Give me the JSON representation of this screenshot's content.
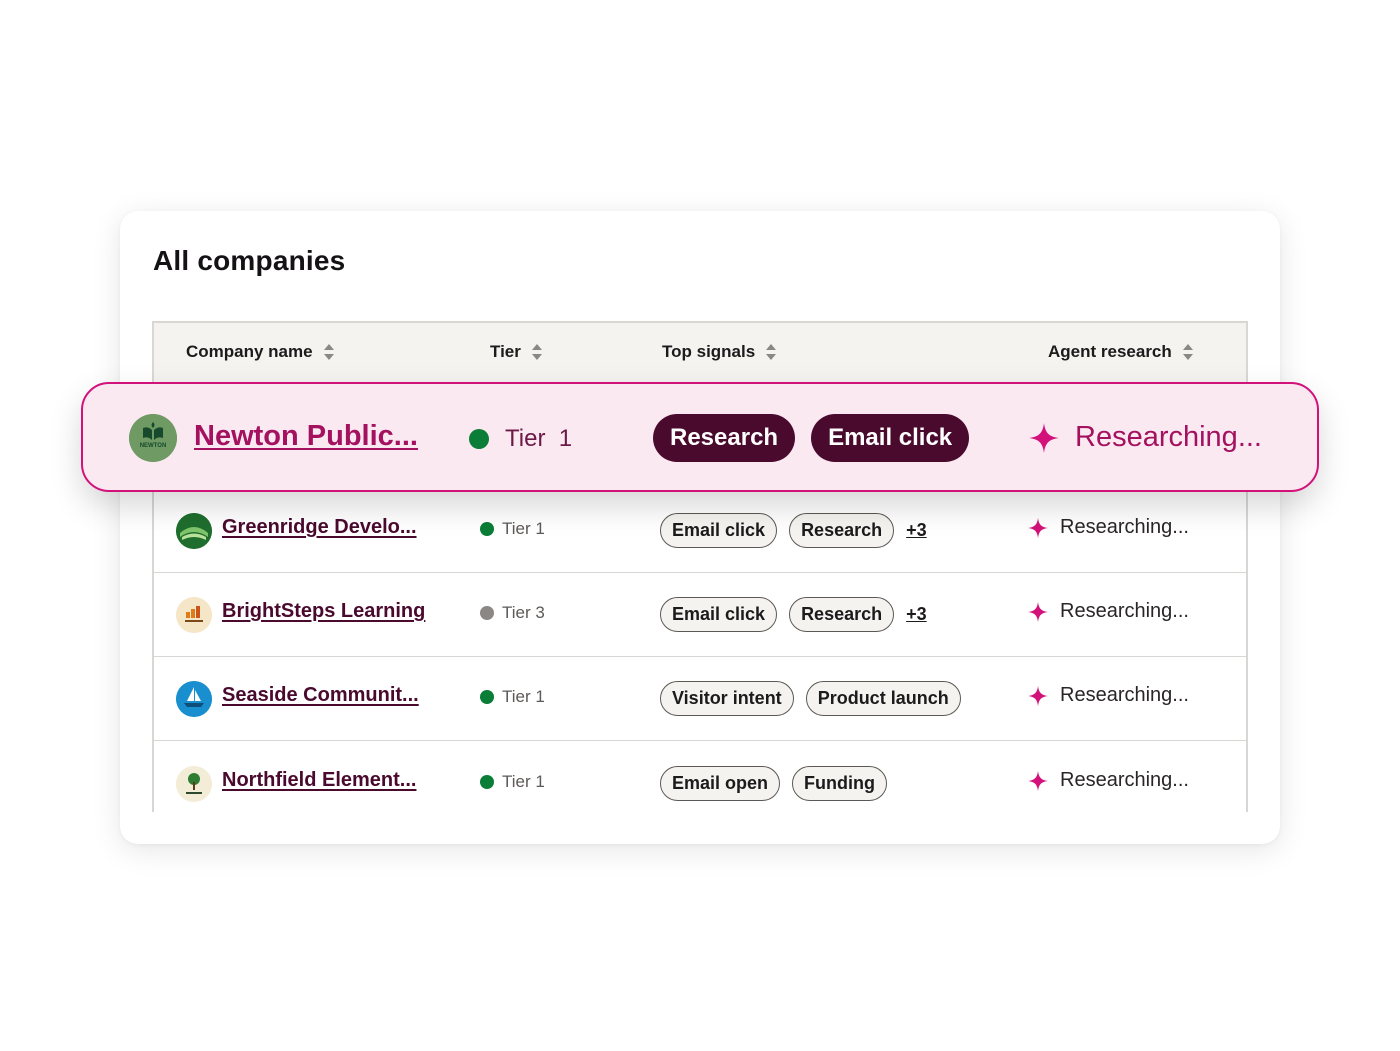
{
  "title": "All companies",
  "columns": [
    {
      "label": "Company name"
    },
    {
      "label": "Tier"
    },
    {
      "label": "Top signals"
    },
    {
      "label": "Agent research"
    }
  ],
  "highlighted_row": {
    "company": "Newton Public...",
    "logo_text": "NEWTON",
    "tier": "Tier  1",
    "tier_color": "#0a7d36",
    "signals": [
      "Research",
      "Email click"
    ],
    "research_status": "Researching..."
  },
  "rows": [
    {
      "company": "Greenridge Develo...",
      "logo_text": "GREENRIDGE",
      "tier": "Tier 1",
      "tier_color": "#0a7d36",
      "signals": [
        "Email click",
        "Research"
      ],
      "more": "+3",
      "research_status": "Researching..."
    },
    {
      "company": "BrightSteps Learning",
      "logo_text": "BRIGHTSTEPS",
      "tier": "Tier 3",
      "tier_color": "#8a8784",
      "signals": [
        "Email click",
        "Research"
      ],
      "more": "+3",
      "research_status": "Researching..."
    },
    {
      "company": "Seaside Communit...",
      "logo_text": "SEASIDE",
      "tier": "Tier 1",
      "tier_color": "#0a7d36",
      "signals": [
        "Visitor intent",
        "Product launch"
      ],
      "more": "",
      "research_status": "Researching..."
    },
    {
      "company": "Northfield Element...",
      "logo_text": "NORTHFIELD",
      "tier": "Tier 1",
      "tier_color": "#0a7d36",
      "signals": [
        "Email open",
        "Funding"
      ],
      "more": "",
      "research_status": "Researching..."
    }
  ],
  "colors": {
    "accent": "#d3117a",
    "brand_dark": "#4a0a2e",
    "tier_green": "#0a7d36",
    "tier_gray": "#8a8784"
  },
  "icons": [
    "sort-icon",
    "sparkle-icon"
  ]
}
